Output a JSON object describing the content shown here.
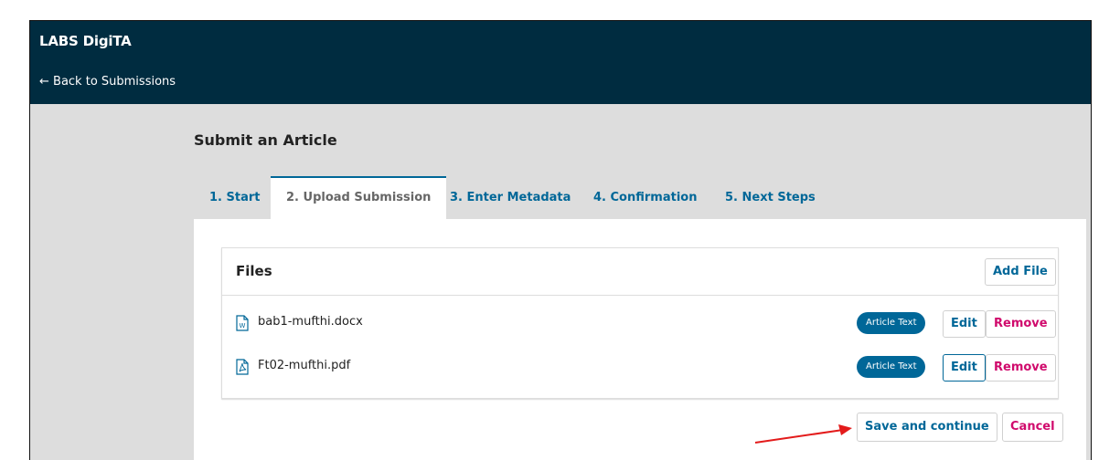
{
  "header": {
    "brand": "LABS DigiTA",
    "back_link": "← Back to Submissions"
  },
  "page": {
    "title": "Submit an Article"
  },
  "tabs": [
    {
      "label": "1. Start",
      "active": false
    },
    {
      "label": "2. Upload Submission",
      "active": true
    },
    {
      "label": "3. Enter Metadata",
      "active": false
    },
    {
      "label": "4. Confirmation",
      "active": false
    },
    {
      "label": "5. Next Steps",
      "active": false
    }
  ],
  "files": {
    "title": "Files",
    "add_file_label": "Add File",
    "items": [
      {
        "name": "bab1-mufthi.docx",
        "type_icon": "word-file-icon",
        "genre": "Article Text",
        "edit_label": "Edit",
        "remove_label": "Remove"
      },
      {
        "name": "Ft02-mufthi.pdf",
        "type_icon": "pdf-file-icon",
        "genre": "Article Text",
        "edit_label": "Edit",
        "remove_label": "Remove"
      }
    ]
  },
  "actions": {
    "save_label": "Save and continue",
    "cancel_label": "Cancel"
  },
  "colors": {
    "header_bg": "#002c40",
    "primary": "#006798",
    "danger": "#d00a6c",
    "annotation_arrow": "#e31b1b"
  }
}
